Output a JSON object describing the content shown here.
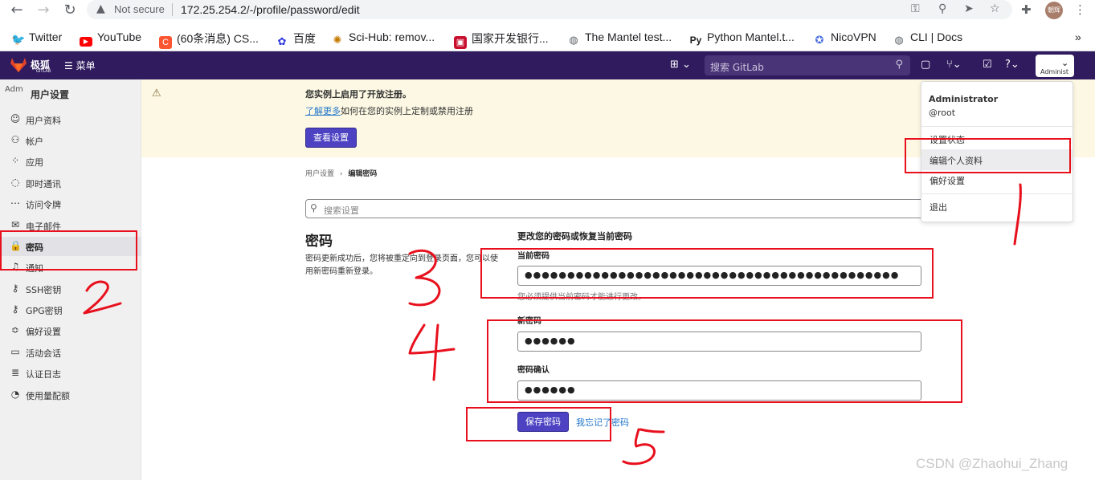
{
  "browser": {
    "security": "Not secure",
    "url": "172.25.254.2/-/profile/password/edit",
    "profile_initials": "朝辉",
    "bookmarks": [
      {
        "label": "Twitter",
        "icon": "twitter-icon",
        "color": "#1da1f2"
      },
      {
        "label": "YouTube",
        "icon": "youtube-icon",
        "color": "#ff0000"
      },
      {
        "label": "(60条消息) CS...",
        "icon": "csdn-icon",
        "color": "#fc5531"
      },
      {
        "label": "百度",
        "icon": "baidu-icon",
        "color": "#2932e1"
      },
      {
        "label": "Sci-Hub: remov...",
        "icon": "scihub-icon",
        "color": "#d4a017"
      },
      {
        "label": "国家开发银行...",
        "icon": "cdb-icon",
        "color": "#c8102e"
      },
      {
        "label": "The Mantel test...",
        "icon": "globe-icon",
        "color": "#5f6368"
      },
      {
        "label": "Python Mantel.t...",
        "icon": "py-icon",
        "color": "#222222"
      },
      {
        "label": "NicoVPN",
        "icon": "nicovpn-icon",
        "color": "#4a6ee0"
      },
      {
        "label": "CLI | Docs",
        "icon": "globe-icon",
        "color": "#5f6368"
      }
    ],
    "more_bookmarks": "»"
  },
  "header": {
    "brand": "极狐",
    "brand_sub": "GITLAB",
    "menu_label": "菜单",
    "search_placeholder": "搜索 GitLab",
    "user_label": "Administ"
  },
  "sidebar": {
    "avatar_alt": "Adm",
    "title": "用户设置",
    "items": [
      {
        "label": "用户资料",
        "icon": "profile-icon",
        "glyph": "☺"
      },
      {
        "label": "帐户",
        "icon": "account-icon",
        "glyph": "⚇"
      },
      {
        "label": "应用",
        "icon": "applications-icon",
        "glyph": "⁘"
      },
      {
        "label": "即时通讯",
        "icon": "chat-icon",
        "glyph": "◌"
      },
      {
        "label": "访问令牌",
        "icon": "token-icon",
        "glyph": "⋯"
      },
      {
        "label": "电子邮件",
        "icon": "mail-icon",
        "glyph": "✉"
      },
      {
        "label": "密码",
        "icon": "lock-icon",
        "glyph": "🔒"
      },
      {
        "label": "通知",
        "icon": "bell-icon",
        "glyph": "♫"
      },
      {
        "label": "SSH密钥",
        "icon": "key-icon",
        "glyph": "⚷"
      },
      {
        "label": "GPG密钥",
        "icon": "key-icon",
        "glyph": "⚷"
      },
      {
        "label": "偏好设置",
        "icon": "preferences-icon",
        "glyph": "≎"
      },
      {
        "label": "活动会话",
        "icon": "monitor-icon",
        "glyph": "▭"
      },
      {
        "label": "认证日志",
        "icon": "log-icon",
        "glyph": "≣"
      },
      {
        "label": "使用量配额",
        "icon": "quota-icon",
        "glyph": "◔"
      }
    ]
  },
  "banner": {
    "title": "您实例上启用了开放注册。",
    "link": "了解更多",
    "text": "如何在您的实例上定制或禁用注册",
    "button": "查看设置"
  },
  "breadcrumb": {
    "parent": "用户设置",
    "separator": "›",
    "current": "编辑密码"
  },
  "search": {
    "placeholder": "搜索设置"
  },
  "section": {
    "title": "密码",
    "description": "密码更新成功后，您将被重定向到登录页面，您可以使用新密码重新登录。"
  },
  "form": {
    "heading": "更改您的密码或恢复当前密码",
    "current_label": "当前密码",
    "current_value": "●●●●●●●●●●●●●●●●●●●●●●●●●●●●●●●●●●●●●●●●●●●●",
    "current_help": "您必须提供当前密码才能进行更改。",
    "new_label": "新密码",
    "new_value": "●●●●●●",
    "confirm_label": "密码确认",
    "confirm_value": "●●●●●●",
    "save_button": "保存密码",
    "forgot_link": "我忘记了密码"
  },
  "user_menu": {
    "name": "Administrator",
    "username": "@root",
    "items": [
      "设置状态",
      "编辑个人资料",
      "偏好设置",
      "退出"
    ]
  },
  "annotations": {
    "numbers": [
      "1",
      "2",
      "3",
      "4",
      "5"
    ],
    "color": "#e8101d"
  },
  "watermark": "CSDN @Zhaohui_Zhang"
}
